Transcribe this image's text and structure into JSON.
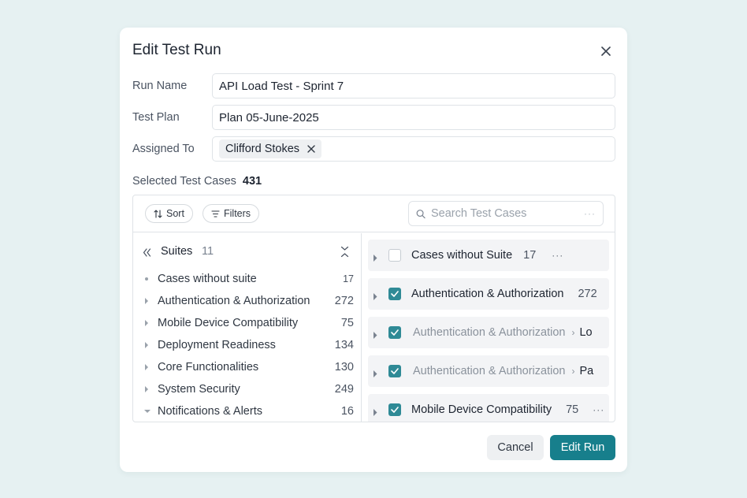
{
  "dialog": {
    "title": "Edit Test Run"
  },
  "form": {
    "run_name_label": "Run Name",
    "run_name_value": "API Load Test - Sprint 7",
    "test_plan_label": "Test Plan",
    "test_plan_value": "Plan 05-June-2025",
    "assigned_to_label": "Assigned To",
    "assigned_to_chip": "Clifford Stokes"
  },
  "selected": {
    "label": "Selected Test Cases",
    "count": "431"
  },
  "toolbar": {
    "sort_label": "Sort",
    "filters_label": "Filters",
    "search_placeholder": "Search Test Cases",
    "search_more": "···"
  },
  "suites": {
    "title": "Suites",
    "count": "11",
    "items": [
      {
        "label": "Cases without suite",
        "count": "17",
        "caret": "dot"
      },
      {
        "label": "Authentication & Authorization",
        "count": "272",
        "caret": "right"
      },
      {
        "label": "Mobile Device Compatibility",
        "count": "75",
        "caret": "right"
      },
      {
        "label": "Deployment Readiness",
        "count": "134",
        "caret": "right"
      },
      {
        "label": "Core Functionalities",
        "count": "130",
        "caret": "right"
      },
      {
        "label": "System Security",
        "count": "249",
        "caret": "right"
      },
      {
        "label": "Notifications & Alerts",
        "count": "16",
        "caret": "down"
      }
    ]
  },
  "cases": [
    {
      "label": "Cases without Suite",
      "count": "17",
      "more": "···",
      "checked": false
    },
    {
      "label": "Authentication & Authorization",
      "count": "272",
      "checked": true
    },
    {
      "label": "Authentication & Authorization",
      "crumb": "Lo",
      "checked": true
    },
    {
      "label": "Authentication & Authorization",
      "crumb": "Pa",
      "checked": true
    },
    {
      "label": "Mobile Device Compatibility",
      "count": "75",
      "more": "···",
      "checked": true
    }
  ],
  "footer": {
    "cancel_label": "Cancel",
    "submit_label": "Edit Run"
  },
  "colors": {
    "primary": "#177f8c",
    "checkbox": "#2f8a96",
    "background": "#e6f1f2"
  },
  "icons": [
    "close-icon",
    "sort-icon",
    "filter-icon",
    "search-icon",
    "collapse-left-icon",
    "collapse-all-icon",
    "caret-right-icon",
    "caret-down-icon",
    "check-icon"
  ]
}
